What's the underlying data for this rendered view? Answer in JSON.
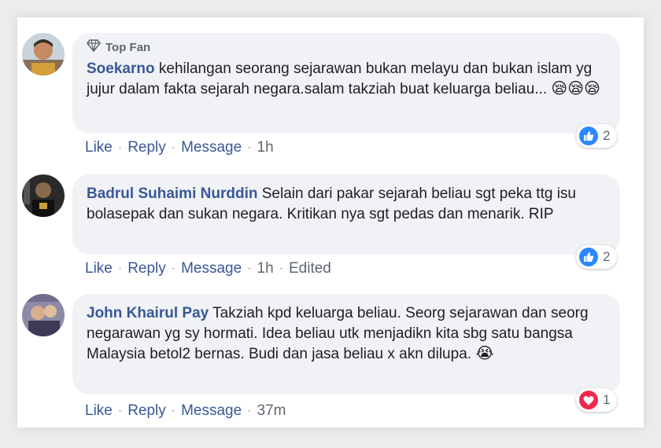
{
  "comments": [
    {
      "badge": "Top Fan",
      "author": "Soekarno",
      "text": "kehilangan seorang sejarawan bukan melayu dan bukan islam yg jujur dalam fakta sejarah negara.salam takziah buat keluarga beliau...",
      "emoji": [
        "sad-sleepy-emoji",
        "sad-sleepy-emoji",
        "sad-sleepy-emoji"
      ],
      "actions": {
        "like": "Like",
        "reply": "Reply",
        "message": "Message",
        "time": "1h"
      },
      "reaction": {
        "type": "like",
        "count": "2",
        "color": "#2d88ff"
      }
    },
    {
      "author": "Badrul Suhaimi Nurddin",
      "text": "Selain dari pakar sejarah beliau sgt peka ttg isu bolasepak dan sukan negara. Kritikan nya sgt pedas dan menarik. RIP",
      "actions": {
        "like": "Like",
        "reply": "Reply",
        "message": "Message",
        "time": "1h",
        "edited": "Edited"
      },
      "reaction": {
        "type": "like",
        "count": "2",
        "color": "#2d88ff"
      }
    },
    {
      "author": "John Khairul Pay",
      "text": "Takziah kpd keluarga beliau. Seorg sejarawan dan seorg negarawan yg sy hormati. Idea beliau utk menjadikn kita sbg satu bangsa Malaysia betol2 bernas. Budi dan jasa beliau x akn dilupa.",
      "emoji": [
        "crying-emoji"
      ],
      "actions": {
        "like": "Like",
        "reply": "Reply",
        "message": "Message",
        "time": "37m"
      },
      "reaction": {
        "type": "love",
        "count": "1",
        "color": "#f0284a"
      }
    }
  ],
  "separator": "·"
}
